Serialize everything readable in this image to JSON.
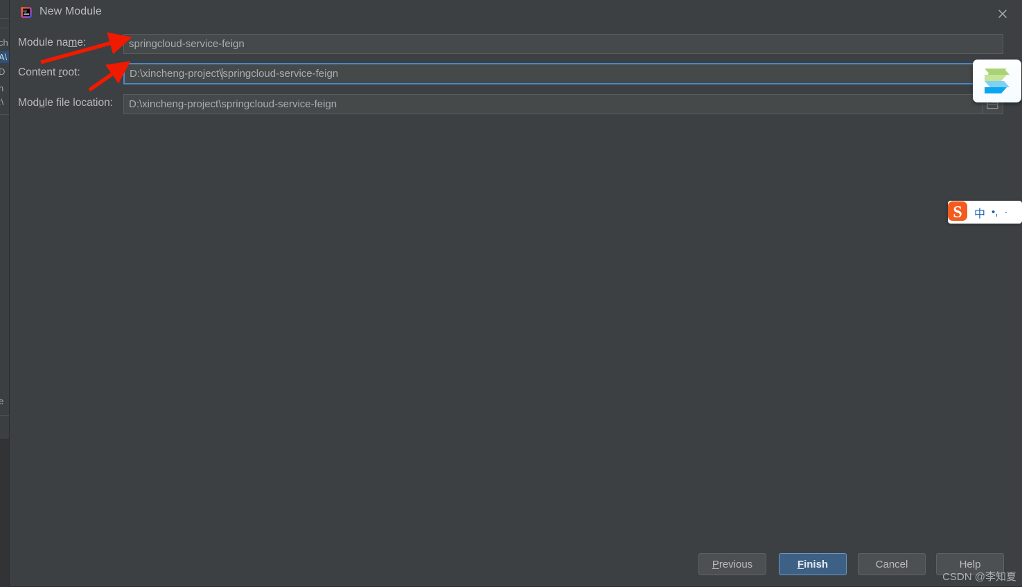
{
  "window": {
    "title": "New Module",
    "app_icon": "intellij-idea-icon",
    "close_label": "✕"
  },
  "dialog": {
    "background_color": "#3c4043",
    "fields": [
      {
        "label_prefix": "Module na",
        "label_mnemonic": "m",
        "label_suffix": "e:",
        "label_full": "Module name:",
        "value": "springcloud-service-feign",
        "focused": false,
        "has_browse_button": false
      },
      {
        "label_prefix": "Content ",
        "label_mnemonic": "r",
        "label_suffix": "oot:",
        "label_full": "Content root:",
        "value_before_caret": "D:\\xincheng-project\\",
        "value_after_caret": "springcloud-service-feign",
        "value": "D:\\xincheng-project\\springcloud-service-feign",
        "focused": true,
        "has_browse_button": true,
        "browse_icon": "folder-icon"
      },
      {
        "label_prefix": "Mod",
        "label_mnemonic": "u",
        "label_suffix": "le file location:",
        "label_full": "Module file location:",
        "value": "D:\\xincheng-project\\springcloud-service-feign",
        "focused": false,
        "has_browse_button": true,
        "browse_icon": "folder-icon"
      }
    ]
  },
  "buttons": {
    "previous": {
      "prefix": "",
      "mnemonic": "P",
      "suffix": "revious",
      "label": "Previous",
      "primary": false
    },
    "finish": {
      "prefix": "",
      "mnemonic": "F",
      "suffix": "inish",
      "label": "Finish",
      "primary": true
    },
    "cancel": {
      "prefix": "Cancel",
      "mnemonic": "",
      "suffix": "",
      "label": "Cancel",
      "primary": false
    },
    "help": {
      "prefix": "Help",
      "mnemonic": "",
      "suffix": "",
      "label": "Help",
      "primary": false
    }
  },
  "annotations": {
    "arrow_color": "#f01a00",
    "arrows": [
      {
        "name": "arrow-to-module-name",
        "points_to": "module-name-field"
      },
      {
        "name": "arrow-to-content-root",
        "points_to": "content-root-field"
      }
    ]
  },
  "overlays": {
    "snipaste": {
      "name": "snipaste-floating-icon"
    },
    "sogou_ime": {
      "name": "sogou-input-method-bar",
      "mode": "中",
      "punctuation": "•,",
      "extra": "·"
    }
  },
  "watermark": {
    "text": "CSDN @李知夏"
  },
  "ide_backdrop": {
    "left_fragments": [
      "ch",
      "A\\",
      "D",
      "n",
      ":\\",
      "e"
    ],
    "selected_fragment_index": 1
  }
}
